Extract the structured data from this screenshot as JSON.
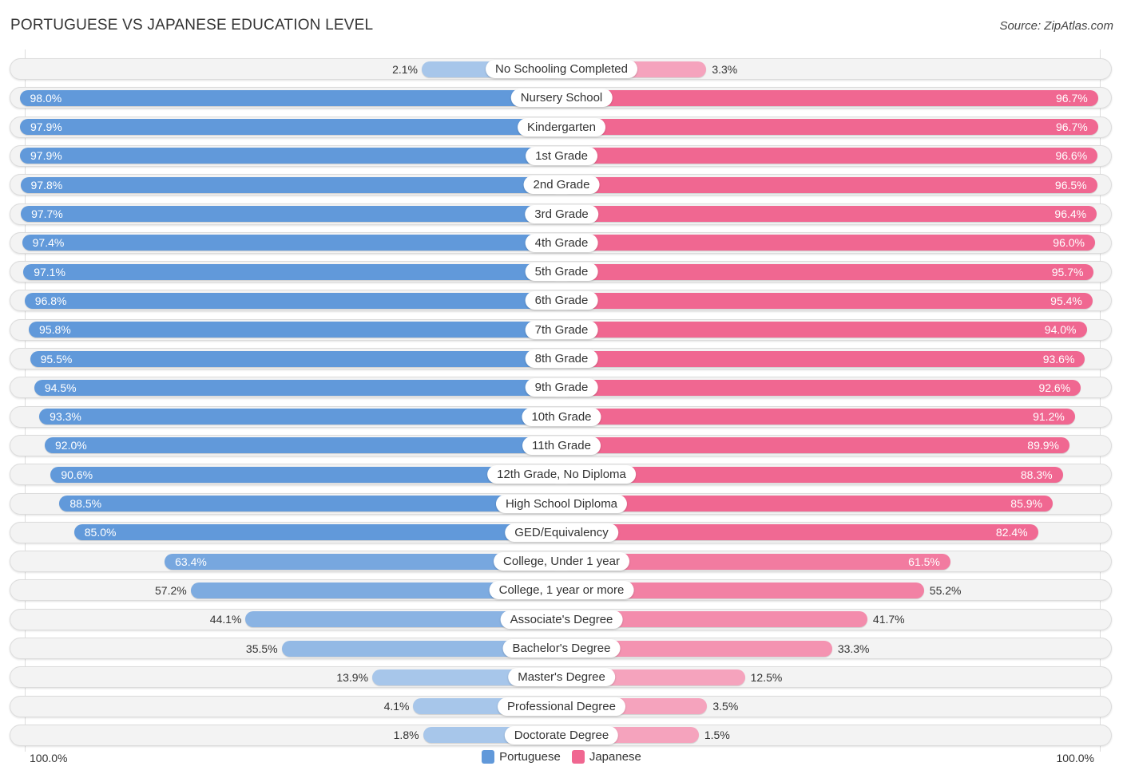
{
  "title": "PORTUGUESE VS JAPANESE EDUCATION LEVEL",
  "source": "Source: ZipAtlas.com",
  "colors": {
    "portuguese_strong": "#6199da",
    "portuguese_light": "#a7c6ea",
    "japanese_strong": "#f06791",
    "japanese_light": "#f5a3bd"
  },
  "axis": {
    "left_label": "100.0%",
    "right_label": "100.0%"
  },
  "legend": [
    {
      "name": "Portuguese",
      "color": "#6199da"
    },
    {
      "name": "Japanese",
      "color": "#f06791"
    }
  ],
  "chart_data": {
    "type": "bar",
    "orientation": "horizontal-diverging",
    "title": "PORTUGUESE VS JAPANESE EDUCATION LEVEL",
    "xlabel": "",
    "ylabel": "",
    "xlim": [
      0,
      100
    ],
    "unit": "%",
    "legend_position": "bottom-center",
    "categories": [
      "No Schooling Completed",
      "Nursery School",
      "Kindergarten",
      "1st Grade",
      "2nd Grade",
      "3rd Grade",
      "4th Grade",
      "5th Grade",
      "6th Grade",
      "7th Grade",
      "8th Grade",
      "9th Grade",
      "10th Grade",
      "11th Grade",
      "12th Grade, No Diploma",
      "High School Diploma",
      "GED/Equivalency",
      "College, Under 1 year",
      "College, 1 year or more",
      "Associate's Degree",
      "Bachelor's Degree",
      "Master's Degree",
      "Professional Degree",
      "Doctorate Degree"
    ],
    "series": [
      {
        "name": "Portuguese",
        "side": "left",
        "values": [
          2.1,
          98.0,
          97.9,
          97.9,
          97.8,
          97.7,
          97.4,
          97.1,
          96.8,
          95.8,
          95.5,
          94.5,
          93.3,
          92.0,
          90.6,
          88.5,
          85.0,
          63.4,
          57.2,
          44.1,
          35.5,
          13.9,
          4.1,
          1.8
        ],
        "labels": [
          "2.1%",
          "98.0%",
          "97.9%",
          "97.9%",
          "97.8%",
          "97.7%",
          "97.4%",
          "97.1%",
          "96.8%",
          "95.8%",
          "95.5%",
          "94.5%",
          "93.3%",
          "92.0%",
          "90.6%",
          "88.5%",
          "85.0%",
          "63.4%",
          "57.2%",
          "44.1%",
          "35.5%",
          "13.9%",
          "4.1%",
          "1.8%"
        ]
      },
      {
        "name": "Japanese",
        "side": "right",
        "values": [
          3.3,
          96.7,
          96.7,
          96.6,
          96.5,
          96.4,
          96.0,
          95.7,
          95.4,
          94.0,
          93.6,
          92.6,
          91.2,
          89.9,
          88.3,
          85.9,
          82.4,
          61.5,
          55.2,
          41.7,
          33.3,
          12.5,
          3.5,
          1.5
        ],
        "labels": [
          "3.3%",
          "96.7%",
          "96.7%",
          "96.6%",
          "96.5%",
          "96.4%",
          "96.0%",
          "95.7%",
          "95.4%",
          "94.0%",
          "93.6%",
          "92.6%",
          "91.2%",
          "89.9%",
          "88.3%",
          "85.9%",
          "82.4%",
          "61.5%",
          "55.2%",
          "41.7%",
          "33.3%",
          "12.5%",
          "3.5%",
          "1.5%"
        ]
      }
    ]
  }
}
